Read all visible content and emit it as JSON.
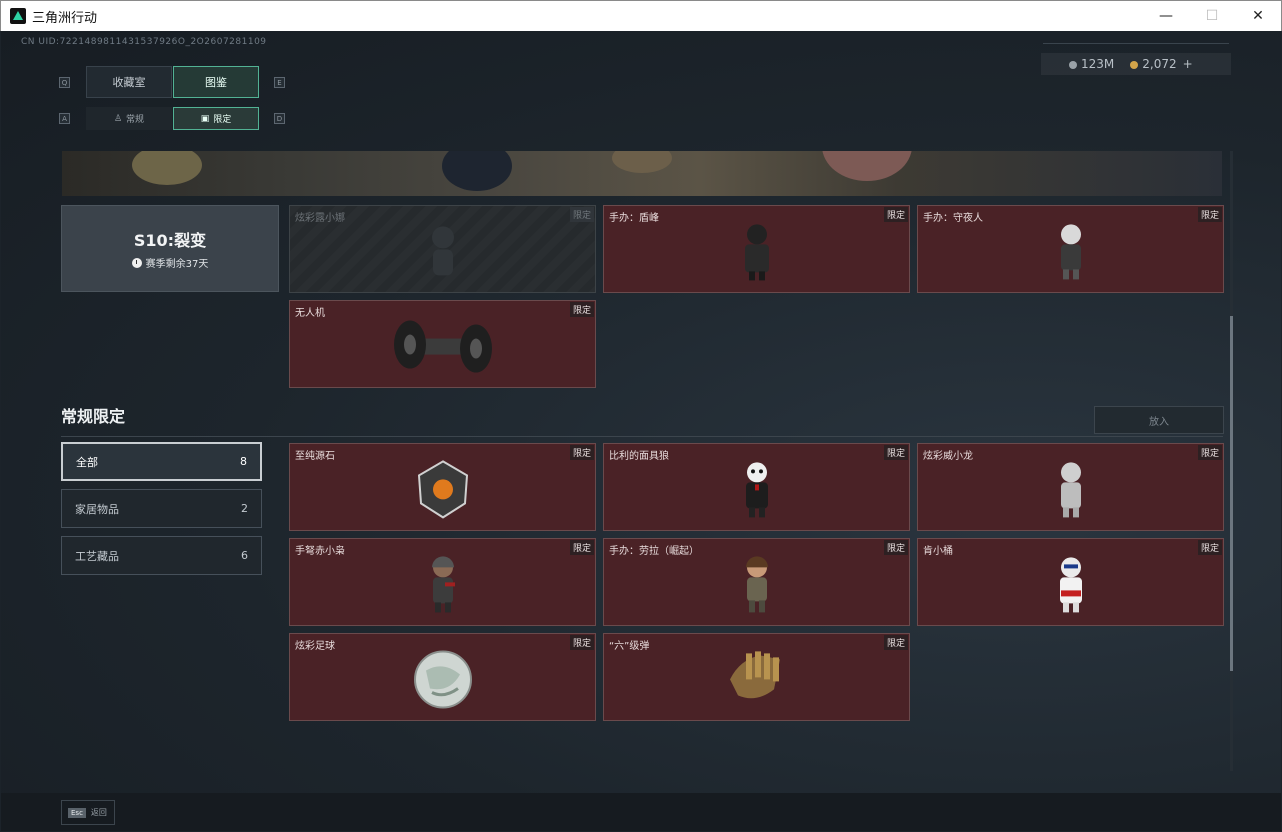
{
  "window": {
    "title": "三角洲行动",
    "minimize": "—",
    "maximize": "☐",
    "close": "✕"
  },
  "header": {
    "uid": "CN UID:7221489811431537926O_2O2607281109",
    "currency_silver": "123M",
    "currency_gold": "2,072",
    "add": "+"
  },
  "tabs_main": {
    "key_left": "Q",
    "key_right": "E",
    "items": [
      {
        "label": "收藏室"
      },
      {
        "label": "图鉴"
      }
    ]
  },
  "tabs_sub": {
    "key_left": "A",
    "key_right": "D",
    "items": [
      {
        "label": "常规"
      },
      {
        "label": "限定"
      }
    ]
  },
  "season": {
    "title": "S10:裂变",
    "remaining": "赛季剩余37天"
  },
  "season_items": [
    {
      "name": "炫彩露小娜",
      "badge": "限定"
    },
    {
      "name": "手办：盾峰",
      "badge": "限定"
    },
    {
      "name": "手办：守夜人",
      "badge": "限定"
    },
    {
      "name": "无人机",
      "badge": "限定"
    }
  ],
  "section": {
    "title": "常规限定",
    "put_in": "放入"
  },
  "filters": [
    {
      "label": "全部",
      "count": "8"
    },
    {
      "label": "家居物品",
      "count": "2"
    },
    {
      "label": "工艺藏品",
      "count": "6"
    }
  ],
  "items": [
    {
      "name": "至纯源石",
      "badge": "限定"
    },
    {
      "name": "比利的面具狼",
      "badge": "限定"
    },
    {
      "name": "炫彩威小龙",
      "badge": "限定"
    },
    {
      "name": "手弩赤小枭",
      "badge": "限定"
    },
    {
      "name": "手办：劳拉（崛起）",
      "badge": "限定"
    },
    {
      "name": "肯小桶",
      "badge": "限定"
    },
    {
      "name": "炫彩足球",
      "badge": "限定"
    },
    {
      "name": "“六”级弹",
      "badge": "限定"
    }
  ],
  "footer": {
    "esc_key": "Esc",
    "back": "返回"
  }
}
